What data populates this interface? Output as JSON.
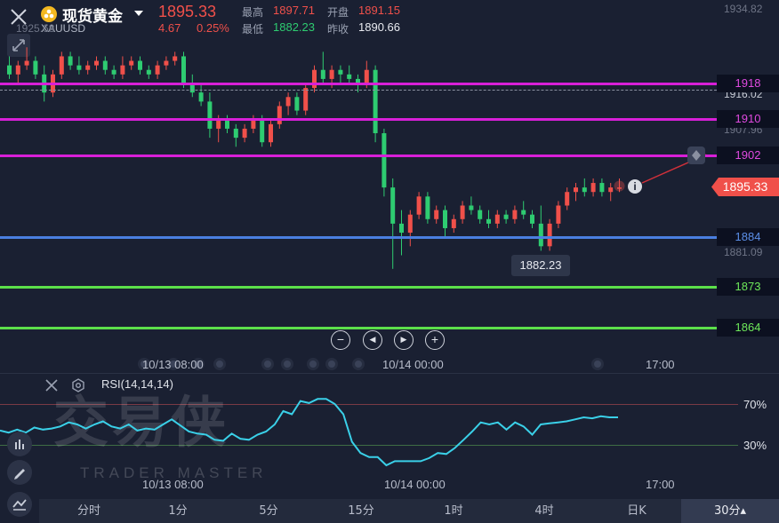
{
  "header": {
    "symbol_name": "现货黄金",
    "symbol_code": "XAUUSD",
    "price": "1895.33",
    "change": "4.67",
    "change_pct": "0.25%",
    "high_label": "最高",
    "high": "1897.71",
    "open_label": "开盘",
    "open": "1891.15",
    "low_label": "最低",
    "low": "1882.23",
    "prev_close_label": "昨收",
    "prev_close": "1890.66"
  },
  "axis": {
    "top_max": "1934.82",
    "left_max": "1925.68",
    "mid_1": "1907.96",
    "mid_2": "1881.09",
    "behind_1918": "1916.02"
  },
  "levels": [
    {
      "label": "1918",
      "color": "#d81fd8"
    },
    {
      "label": "1910",
      "color": "#d81fd8"
    },
    {
      "label": "1902",
      "color": "#d81fd8"
    },
    {
      "label": "1884",
      "color": "#4a7fe0"
    },
    {
      "label": "1873",
      "color": "#5ce04a"
    },
    {
      "label": "1864",
      "color": "#5ce04a"
    }
  ],
  "current_price_tag": "1895.33",
  "low_tooltip": "1882.23",
  "info_icon": "i",
  "zoom_controls": {
    "minus": "−",
    "prev": "◀",
    "next": "▶",
    "plus": "+"
  },
  "time_labels": {
    "t1": "10/13 08:00",
    "t2": "10/14 00:00",
    "t3": "17:00"
  },
  "rsi": {
    "label": "RSI(14,14,14)",
    "upper": "70%",
    "lower": "30%",
    "line_color": "#3ad0e8",
    "values": [
      44,
      42,
      45,
      42,
      47,
      45,
      46,
      48,
      52,
      50,
      46,
      50,
      53,
      48,
      46,
      50,
      44,
      46,
      45,
      50,
      55,
      49,
      43,
      41,
      40,
      35,
      34,
      41,
      36,
      35,
      40,
      43,
      50,
      63,
      60,
      73,
      71,
      75,
      75,
      70,
      60,
      33,
      22,
      18,
      18,
      10,
      14,
      14,
      14,
      14,
      17,
      22,
      21,
      27,
      35,
      43,
      52,
      50,
      52,
      45,
      52,
      48,
      40,
      50,
      51,
      52,
      53,
      55,
      57,
      56,
      58,
      57,
      57
    ]
  },
  "watermark": {
    "main": "交易侠",
    "sub": "TRADER MASTER"
  },
  "tabs": [
    "分时",
    "1分",
    "5分",
    "15分",
    "1时",
    "4时",
    "日K",
    "30分▴"
  ],
  "colors": {
    "up": "#f0504a",
    "down": "#2ecc71",
    "bg": "#1a2032"
  },
  "candles": [
    [
      1922,
      1924,
      1919,
      1920
    ],
    [
      1920,
      1923,
      1918,
      1922
    ],
    [
      1922,
      1926,
      1921,
      1923
    ],
    [
      1923,
      1924,
      1919,
      1920
    ],
    [
      1920,
      1922,
      1914,
      1916
    ],
    [
      1916,
      1921,
      1915,
      1920
    ],
    [
      1920,
      1925,
      1919,
      1924
    ],
    [
      1924,
      1925,
      1921,
      1922
    ],
    [
      1922,
      1924,
      1920,
      1921
    ],
    [
      1921,
      1923,
      1920,
      1922
    ],
    [
      1922,
      1924,
      1921,
      1923
    ],
    [
      1923,
      1924,
      1920,
      1921
    ],
    [
      1921,
      1922,
      1919,
      1920
    ],
    [
      1920,
      1924,
      1919,
      1922
    ],
    [
      1922,
      1924,
      1921,
      1923
    ],
    [
      1923,
      1924,
      1920,
      1921
    ],
    [
      1921,
      1922,
      1919,
      1920
    ],
    [
      1920,
      1923,
      1919,
      1922
    ],
    [
      1922,
      1924,
      1921,
      1923
    ],
    [
      1923,
      1925,
      1922,
      1924
    ],
    [
      1924,
      1925,
      1917,
      1918
    ],
    [
      1918,
      1920,
      1915,
      1916
    ],
    [
      1916,
      1918,
      1913,
      1914
    ],
    [
      1914,
      1916,
      1906,
      1908
    ],
    [
      1908,
      1911,
      1905,
      1910
    ],
    [
      1910,
      1911,
      1907,
      1908
    ],
    [
      1908,
      1909,
      1904,
      1906
    ],
    [
      1906,
      1909,
      1905,
      1908
    ],
    [
      1908,
      1911,
      1907,
      1910
    ],
    [
      1910,
      1911,
      1904,
      1905
    ],
    [
      1905,
      1910,
      1904,
      1909
    ],
    [
      1909,
      1914,
      1908,
      1913
    ],
    [
      1913,
      1916,
      1911,
      1915
    ],
    [
      1915,
      1916,
      1911,
      1912
    ],
    [
      1912,
      1918,
      1911,
      1917
    ],
    [
      1917,
      1922,
      1916,
      1921
    ],
    [
      1921,
      1925,
      1918,
      1919
    ],
    [
      1919,
      1922,
      1917,
      1921
    ],
    [
      1921,
      1922,
      1918,
      1920
    ],
    [
      1920,
      1922,
      1918,
      1919
    ],
    [
      1919,
      1920,
      1916,
      1918
    ],
    [
      1918,
      1923,
      1917,
      1921
    ],
    [
      1921,
      1922,
      1905,
      1907
    ],
    [
      1907,
      1908,
      1893,
      1895
    ],
    [
      1895,
      1897,
      1877,
      1887
    ],
    [
      1887,
      1890,
      1880,
      1885
    ],
    [
      1885,
      1890,
      1882,
      1889
    ],
    [
      1889,
      1894,
      1888,
      1893
    ],
    [
      1893,
      1894,
      1887,
      1888
    ],
    [
      1888,
      1891,
      1887,
      1890
    ],
    [
      1890,
      1891,
      1884,
      1886
    ],
    [
      1886,
      1889,
      1885,
      1888
    ],
    [
      1888,
      1892,
      1887,
      1891
    ],
    [
      1891,
      1893,
      1889,
      1890
    ],
    [
      1890,
      1891,
      1887,
      1888
    ],
    [
      1888,
      1890,
      1886,
      1887
    ],
    [
      1887,
      1890,
      1886,
      1889
    ],
    [
      1889,
      1890,
      1887,
      1888
    ],
    [
      1888,
      1891,
      1887,
      1890
    ],
    [
      1890,
      1892,
      1888,
      1889
    ],
    [
      1889,
      1890,
      1886,
      1887
    ],
    [
      1887,
      1891,
      1881,
      1882
    ],
    [
      1882,
      1888,
      1881,
      1887
    ],
    [
      1887,
      1892,
      1886,
      1891
    ],
    [
      1891,
      1895,
      1890,
      1894
    ],
    [
      1894,
      1896,
      1892,
      1895
    ],
    [
      1895,
      1897,
      1893,
      1894
    ],
    [
      1894,
      1897,
      1893,
      1896
    ],
    [
      1896,
      1897,
      1893,
      1894
    ],
    [
      1894,
      1896,
      1892,
      1895
    ],
    [
      1895,
      1897,
      1894,
      1895
    ]
  ]
}
